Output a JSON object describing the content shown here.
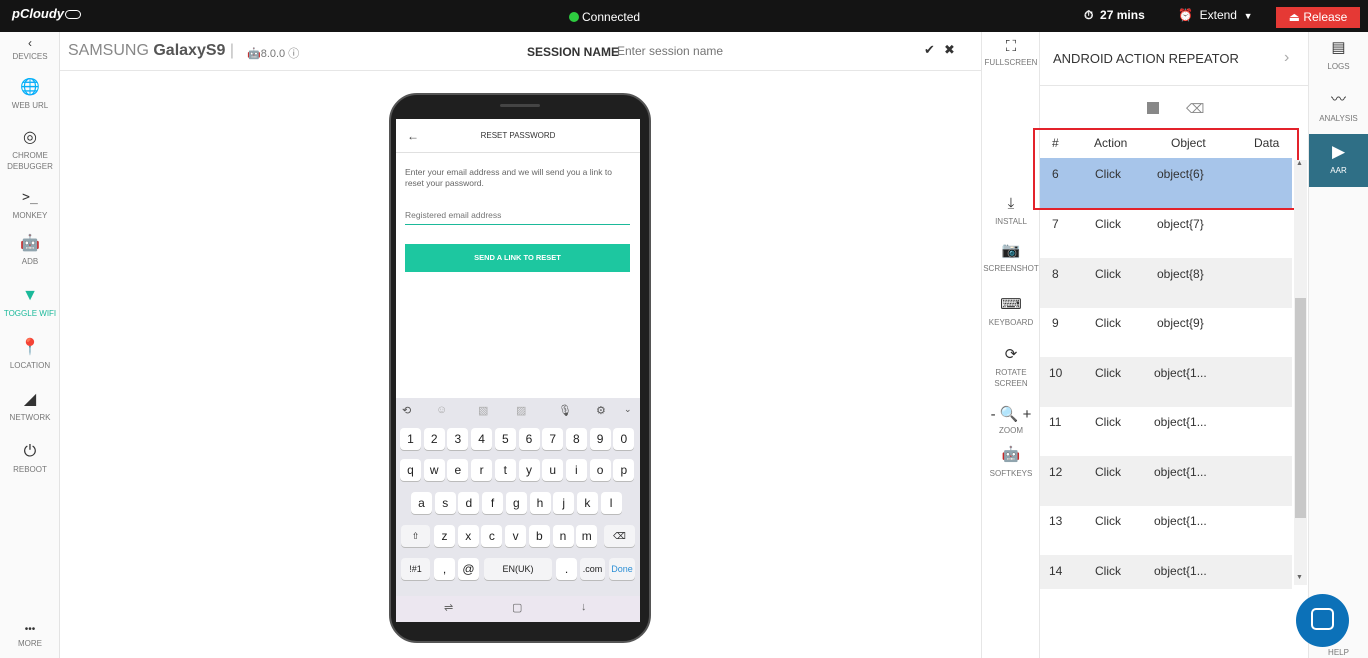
{
  "topbar": {
    "logo": "pCloudy",
    "connection": "Connected",
    "timer": "27 mins",
    "extend": "Extend",
    "release": "Release"
  },
  "leftbar": {
    "items": [
      {
        "label": "DEVICES",
        "icon": "chevron-up-icon"
      },
      {
        "label": "WEB URL",
        "icon": "globe-icon"
      },
      {
        "label": "CHROME DEBUGGER",
        "icon": "chrome-icon"
      },
      {
        "label": "MONKEY",
        "icon": "terminal-icon"
      },
      {
        "label": "ADB",
        "icon": "android-icon"
      },
      {
        "label": "TOGGLE WIFI",
        "icon": "wifi-icon"
      },
      {
        "label": "LOCATION",
        "icon": "location-pin-icon"
      },
      {
        "label": "NETWORK",
        "icon": "signal-icon"
      },
      {
        "label": "REBOOT",
        "icon": "power-icon"
      },
      {
        "label": "MORE",
        "icon": "more-dots-icon"
      }
    ],
    "active_color": "#1bb99a"
  },
  "header": {
    "brand": "SAMSUNG",
    "model": "GalaxyS9",
    "os_version": "8.0.0",
    "session_label": "SESSION NAME",
    "session_placeholder": "Enter session name"
  },
  "phone": {
    "title": "RESET PASSWORD",
    "description": "Enter your email address and we will send you a link to reset your password.",
    "email_placeholder": "Registered email address",
    "button": "SEND A LINK TO RESET",
    "keyboard": {
      "numbers": [
        "1",
        "2",
        "3",
        "4",
        "5",
        "6",
        "7",
        "8",
        "9",
        "0"
      ],
      "row1": [
        "q",
        "w",
        "e",
        "r",
        "t",
        "y",
        "u",
        "i",
        "o",
        "p"
      ],
      "row2": [
        "a",
        "s",
        "d",
        "f",
        "g",
        "h",
        "j",
        "k",
        "l"
      ],
      "row3": [
        "z",
        "x",
        "c",
        "v",
        "b",
        "n",
        "m"
      ],
      "sym": "!#1",
      "comma": ",",
      "at": "@",
      "space": "EN(UK)",
      "period": ".",
      "com": ".com",
      "done": "Done"
    }
  },
  "tools": [
    {
      "label": "FULLSCREEN",
      "icon": "fullscreen-icon"
    },
    {
      "label": "INSTALL",
      "icon": "download-icon"
    },
    {
      "label": "SCREENSHOT",
      "icon": "camera-icon"
    },
    {
      "label": "KEYBOARD",
      "icon": "keyboard-icon"
    },
    {
      "label": "ROTATE SCREEN",
      "icon": "rotate-icon"
    },
    {
      "label": "ZOOM",
      "icon": "zoom-icon"
    },
    {
      "label": "SOFTKEYS",
      "icon": "android-icon"
    }
  ],
  "aar": {
    "title": "ANDROID ACTION REPEATOR",
    "columns": [
      "#",
      "Action",
      "Object",
      "Data"
    ],
    "rows": [
      {
        "num": "6",
        "action": "Click",
        "object": "object{6}",
        "data": ""
      },
      {
        "num": "7",
        "action": "Click",
        "object": "object{7}",
        "data": ""
      },
      {
        "num": "8",
        "action": "Click",
        "object": "object{8}",
        "data": ""
      },
      {
        "num": "9",
        "action": "Click",
        "object": "object{9}",
        "data": ""
      },
      {
        "num": "10",
        "action": "Click",
        "object": "object{1...",
        "data": ""
      },
      {
        "num": "11",
        "action": "Click",
        "object": "object{1...",
        "data": ""
      },
      {
        "num": "12",
        "action": "Click",
        "object": "object{1...",
        "data": ""
      },
      {
        "num": "13",
        "action": "Click",
        "object": "object{1...",
        "data": ""
      },
      {
        "num": "14",
        "action": "Click",
        "object": "object{1...",
        "data": ""
      }
    ],
    "selected_color": "#a7c5ea",
    "highlight_color": "#e3222b"
  },
  "farbar": {
    "items": [
      {
        "label": "LOGS",
        "icon": "logs-icon"
      },
      {
        "label": "ANALYSIS",
        "icon": "analysis-icon"
      },
      {
        "label": "AAR",
        "icon": "play-icon"
      },
      {
        "label": "HELP",
        "icon": "chat-icon"
      }
    ]
  }
}
